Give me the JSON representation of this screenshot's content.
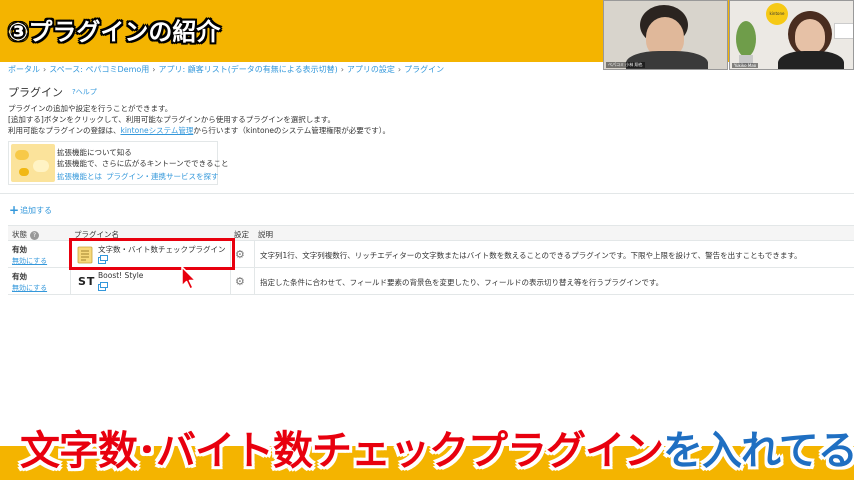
{
  "banner": {
    "title": "③プラグインの紹介"
  },
  "video": {
    "left_label": "ぺパコミ 小林 翔也",
    "right_label": "Yukiko Mao",
    "lamp_text": "kintone"
  },
  "breadcrumb": [
    "ポータル",
    "スペース: ペパコミDemo用",
    "アプリ: 顧客リスト(データの有無による表示切替)",
    "アプリの設定",
    "プラグイン"
  ],
  "page": {
    "title": "プラグイン",
    "help": "?ヘルプ",
    "desc1": "プラグインの追加や設定を行うことができます。",
    "desc2": "[追加する]ボタンをクリックして、利用可能なプラグインから使用するプラグインを選択します。",
    "desc3_pre": "利用可能なプラグインの登録は、",
    "desc3_link": "kintoneシステム管理",
    "desc3_post": "から行います（kintoneのシステム管理権限が必要です）。"
  },
  "info": {
    "title": "拡張機能について知る",
    "text": "拡張機能で、さらに広がるキントーンでできること",
    "link1": "拡張機能とは",
    "link2": "プラグイン・連携サービスを探す"
  },
  "add_button": "追加する",
  "table": {
    "headers": {
      "status": "状態",
      "name": "プラグイン名",
      "settings": "設定",
      "description": "説明"
    },
    "rows": [
      {
        "status": "有効",
        "disable": "無効にする",
        "name": "文字数・バイト数チェックプラグイン",
        "description": "文字列1行、文字列複数行、リッチエディターの文字数またはバイト数を数えることのできるプラグインです。下限や上限を設けて、警告を出すこともできます。"
      },
      {
        "status": "有効",
        "disable": "無効にする",
        "logo": "ST",
        "name": "Boost! Style",
        "description": "指定した条件に合わせて、フィールド要素の背景色を変更したり、フィールドの表示切り替え等を行うプラグインです。"
      }
    ]
  },
  "caption": {
    "part1": "文字数･バイト数チェックプラグイン",
    "part2": "を入れてる"
  },
  "colors": {
    "banner": "#f4b400",
    "link": "#3498db",
    "highlight": "#e8000e",
    "caption_red": "#e8000e",
    "caption_blue": "#1f6fc2"
  }
}
